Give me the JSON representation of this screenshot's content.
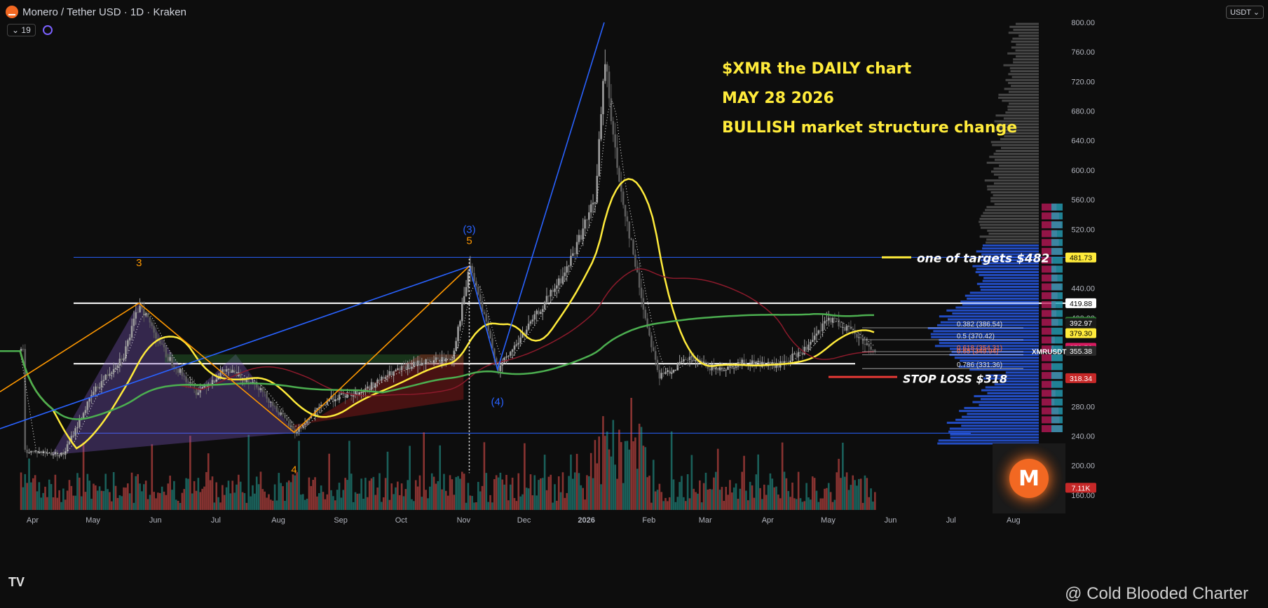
{
  "header": {
    "symbol": "Monero / Tether USD · 1D · Kraken",
    "indicator_count": "19",
    "currency": "USDT"
  },
  "annotations": {
    "line1": "$XMR   the DAILY chart",
    "line2": "MAY 28  2026",
    "line3": "BULLISH market structure change",
    "target": "one of targets $482",
    "stop": "STOP LOSS $318"
  },
  "watermark": "@ Cold Blooded Charter",
  "tv_logo": "TV",
  "avatar_symbol": "M",
  "colors": {
    "background": "#0d0d0d",
    "up": "#9e9e9e",
    "down": "#5c5c5c",
    "ma_fast": "#ffeb3b",
    "ma_slow": "#4caf50",
    "ma_mid": "#8b1a2b",
    "annotation": "#ffeb3b",
    "wave_blue": "#2962ff",
    "wave_orange": "#ff9800"
  },
  "chart_data": {
    "type": "candlestick",
    "ylim": [
      140,
      800
    ],
    "x_months": [
      "Apr",
      "May",
      "Jun",
      "Jul",
      "Aug",
      "Sep",
      "Oct",
      "Nov",
      "Dec",
      "2026",
      "Feb",
      "Mar",
      "Apr",
      "May",
      "Jun",
      "Jul",
      "Aug"
    ],
    "y_ticks": [
      160,
      200,
      240,
      280,
      320,
      360,
      400,
      440,
      480,
      520,
      560,
      600,
      640,
      680,
      720,
      760,
      800
    ],
    "price_series": [
      [
        "2025-04-01",
        220
      ],
      [
        "2025-04-20",
        215
      ],
      [
        "2025-05-05",
        300
      ],
      [
        "2025-05-20",
        350
      ],
      [
        "2025-05-28",
        420
      ],
      [
        "2025-06-10",
        350
      ],
      [
        "2025-06-25",
        300
      ],
      [
        "2025-07-10",
        330
      ],
      [
        "2025-07-25",
        310
      ],
      [
        "2025-08-13",
        245
      ],
      [
        "2025-08-30",
        290
      ],
      [
        "2025-09-15",
        300
      ],
      [
        "2025-09-30",
        325
      ],
      [
        "2025-10-15",
        340
      ],
      [
        "2025-10-30",
        345
      ],
      [
        "2025-11-08",
        470
      ],
      [
        "2025-11-22",
        330
      ],
      [
        "2025-12-05",
        380
      ],
      [
        "2025-12-25",
        460
      ],
      [
        "2026-01-09",
        560
      ],
      [
        "2026-01-14",
        750
      ],
      [
        "2026-01-20",
        600
      ],
      [
        "2026-01-27",
        500
      ],
      [
        "2026-02-03",
        400
      ],
      [
        "2026-02-10",
        320
      ],
      [
        "2026-02-25",
        345
      ],
      [
        "2026-03-10",
        330
      ],
      [
        "2026-03-25",
        340
      ],
      [
        "2026-04-10",
        335
      ],
      [
        "2026-04-25",
        360
      ],
      [
        "2026-05-05",
        400
      ],
      [
        "2026-05-15",
        385
      ],
      [
        "2026-05-28",
        355
      ]
    ],
    "price_labels": [
      {
        "label": "481.73",
        "value": 481.73,
        "color": "#ffeb3b",
        "text": "#000"
      },
      {
        "label": "419.88",
        "value": 419.88,
        "color": "#ffffff",
        "text": "#000"
      },
      {
        "label": "394.77",
        "value": 394.77,
        "color": "#2e7d32",
        "text": "#fff"
      },
      {
        "label": "392.97",
        "value": 392.97,
        "color": "#1a1a1a",
        "text": "#fff"
      },
      {
        "label": "379.30",
        "value": 379.3,
        "color": "#ffeb3b",
        "text": "#000"
      },
      {
        "label": "359.56",
        "value": 359.56,
        "color": "#d81b60",
        "text": "#fff"
      },
      {
        "label": "355.38",
        "value": 355.38,
        "color": "#2a2a2a",
        "text": "#fff"
      },
      {
        "label": "318.34",
        "value": 318.34,
        "color": "#c62828",
        "text": "#fff"
      },
      {
        "label": "7.11K",
        "value": 170,
        "color": "#c62828",
        "text": "#fff"
      }
    ],
    "symbol_tag": "XMRUSDT",
    "fib_levels": [
      {
        "label": "0.382 (386.54)",
        "value": 386.54
      },
      {
        "label": "0.5 (370.42)",
        "value": 370.42
      },
      {
        "label": "0.618 (354.31)",
        "value": 354.31
      },
      {
        "label": "0.65 (349.94)",
        "value": 349.94
      },
      {
        "label": "0.786 (331.36)",
        "value": 331.36
      }
    ],
    "wave_labels": [
      {
        "text": "3",
        "date": "2025-05-28",
        "value": 470,
        "color": "#ff9800"
      },
      {
        "text": "(3)",
        "date": "2025-11-08",
        "value": 515,
        "color": "#2962ff"
      },
      {
        "text": "5",
        "date": "2025-11-08",
        "value": 500,
        "color": "#ff9800"
      },
      {
        "text": "(4)",
        "date": "2025-11-22",
        "value": 282,
        "color": "#2962ff"
      },
      {
        "text": "4",
        "date": "2025-08-13",
        "value": 190,
        "color": "#ff9800"
      }
    ],
    "horizontal_levels": [
      {
        "value": 482,
        "color": "#2962ff"
      },
      {
        "value": 419.88,
        "color": "#ffffff"
      },
      {
        "value": 338,
        "color": "#ffffff"
      },
      {
        "value": 244,
        "color": "#2962ff"
      }
    ]
  }
}
